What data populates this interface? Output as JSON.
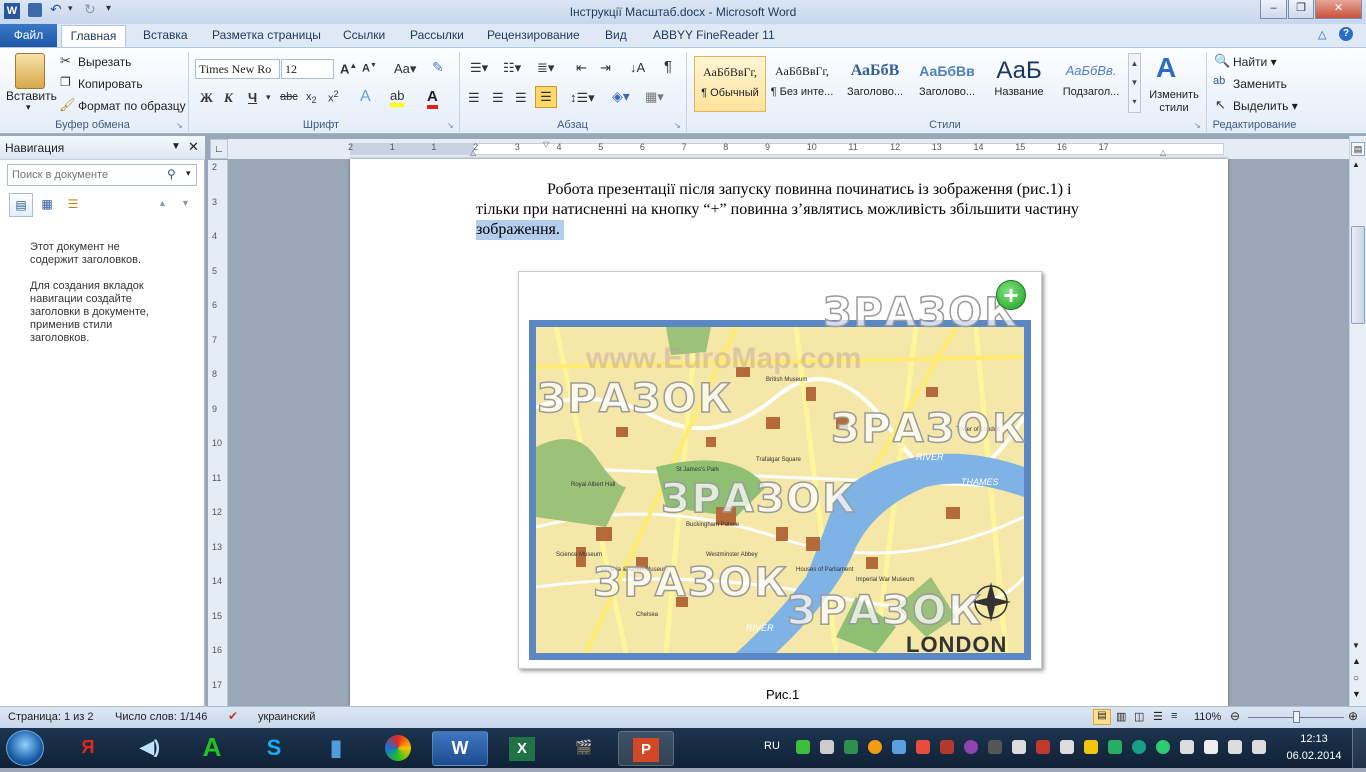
{
  "window": {
    "title": "Інструкції Масштаб.docx - Microsoft Word",
    "controls": [
      "–",
      "❐",
      "✕"
    ]
  },
  "quick_access": {
    "icons": [
      "save-icon",
      "undo-icon",
      "redo-icon",
      "customize-icon"
    ]
  },
  "ribbon_tabs": {
    "file": "Файл",
    "items": [
      "Главная",
      "Вставка",
      "Разметка страницы",
      "Ссылки",
      "Рассылки",
      "Рецензирование",
      "Вид",
      "ABBYY FineReader 11"
    ]
  },
  "clipboard": {
    "paste": "Вставить",
    "cut": "Вырезать",
    "copy": "Копировать",
    "format_painter": "Формат по образцу",
    "group": "Буфер обмена"
  },
  "font": {
    "name": "Times New Ro",
    "size": "12",
    "group": "Шрифт",
    "case_label": "Aa"
  },
  "paragraph": {
    "group": "Абзац"
  },
  "styles": {
    "group": "Стили",
    "items": [
      {
        "preview": "АаБбВвГг,",
        "name": "¶ Обычный"
      },
      {
        "preview": "АаБбВвГг,",
        "name": "¶ Без инте..."
      },
      {
        "preview": "АаБбВ",
        "name": "Заголово..."
      },
      {
        "preview": "АаБбВв",
        "name": "Заголово..."
      },
      {
        "preview": "АаБ",
        "name": "Название"
      },
      {
        "preview": "АаБбВв.",
        "name": "Подзагол..."
      }
    ],
    "change": "Изменить стили"
  },
  "editing": {
    "find": "Найти",
    "replace": "Заменить",
    "select": "Выделить",
    "group": "Редактирование"
  },
  "nav": {
    "title": "Навигация",
    "search_placeholder": "Поиск в документе",
    "msg1": "Этот документ не содержит заголовков.",
    "msg2": "Для создания вкладок навигации создайте заголовки в документе, применив стили заголовков."
  },
  "ruler": {
    "h": [
      "2",
      "1",
      "1",
      "2",
      "3",
      "4",
      "5",
      "6",
      "7",
      "8",
      "9",
      "10",
      "11",
      "12",
      "13",
      "14",
      "15",
      "16",
      "17"
    ],
    "v": [
      "2",
      "3",
      "4",
      "5",
      "6",
      "7",
      "8",
      "9",
      "10",
      "11",
      "12",
      "13",
      "14",
      "15",
      "16",
      "17"
    ]
  },
  "document": {
    "line1": "Робота  презентації  після  запуску  повинна  починатись  із  зображення  (рис.1)  і",
    "line2": "тільки при натисненні на кнопку “+” повинна з’являтись можливість збільшити частину",
    "line3": "зображення. ",
    "caption": "Рис.1"
  },
  "map": {
    "watermarks": [
      "ЗРАЗОК",
      "ЗРАЗОК",
      "ЗРАЗОК",
      "ЗРАЗОК",
      "ЗРАЗОК",
      "ЗРАЗОК"
    ],
    "city": "LONDON",
    "faint_url": "www.EuroMap.com",
    "river": "RIVER",
    "thames": "THAMES",
    "river2": "RIVER",
    "plus": "+",
    "labels": [
      "Royal Albert Hall",
      "Science Museum",
      "Victoria & Albert Museum",
      "Buckingham Palace",
      "St James's Park",
      "Westminster Abbey",
      "Houses of Parliament",
      "Trafalgar Square",
      "British Museum",
      "Tower of London",
      "Imperial War Museum",
      "Chelsea"
    ]
  },
  "status": {
    "page": "Страница: 1 из 2",
    "words": "Число слов: 1/146",
    "lang": "украинский",
    "zoom": "110%"
  },
  "taskbar": {
    "lang": "RU",
    "time": "12:13",
    "date": "06.02.2014",
    "apps": [
      "Я",
      "A",
      "W",
      "X",
      "P"
    ]
  }
}
